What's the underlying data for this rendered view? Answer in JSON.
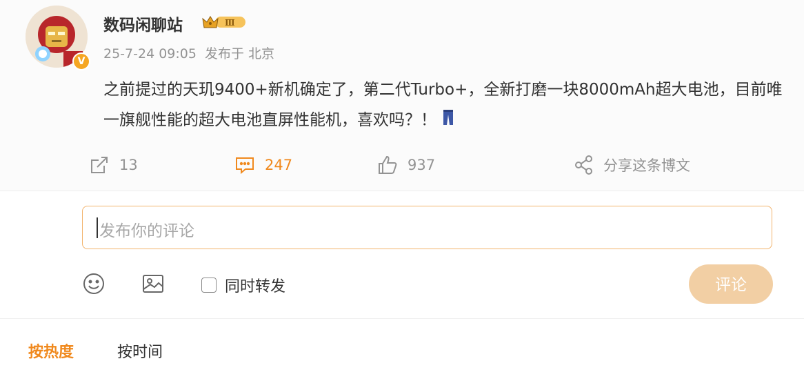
{
  "post": {
    "username": "数码闲聊站",
    "level_badge": "Ⅲ",
    "verified_mark": "V",
    "timestamp": "25-7-24 09:05",
    "posted_from": "发布于 北京",
    "content": "之前提过的天玑9400+新机确定了，第二代Turbo+，全新打磨一块8000mAh超大电池，目前唯一旗舰性能的超大电池直屏性能机，喜欢吗？！"
  },
  "actions": {
    "repost_count": "13",
    "comment_count": "247",
    "like_count": "937",
    "share_label": "分享这条博文"
  },
  "composer": {
    "placeholder": "发布你的评论",
    "forward_label": "同时转发",
    "submit_label": "评论"
  },
  "sort": {
    "hot_label": "按热度",
    "time_label": "按时间"
  },
  "colors": {
    "accent": "#f0891d",
    "submit_disabled": "#f2cfa4",
    "input_border": "#f2b36b",
    "muted_text": "#939393"
  },
  "icons": [
    "repost-icon",
    "comment-icon",
    "like-icon",
    "share-icon",
    "emoji-icon",
    "image-icon",
    "crown-badge-icon",
    "pants-emoji-icon"
  ]
}
